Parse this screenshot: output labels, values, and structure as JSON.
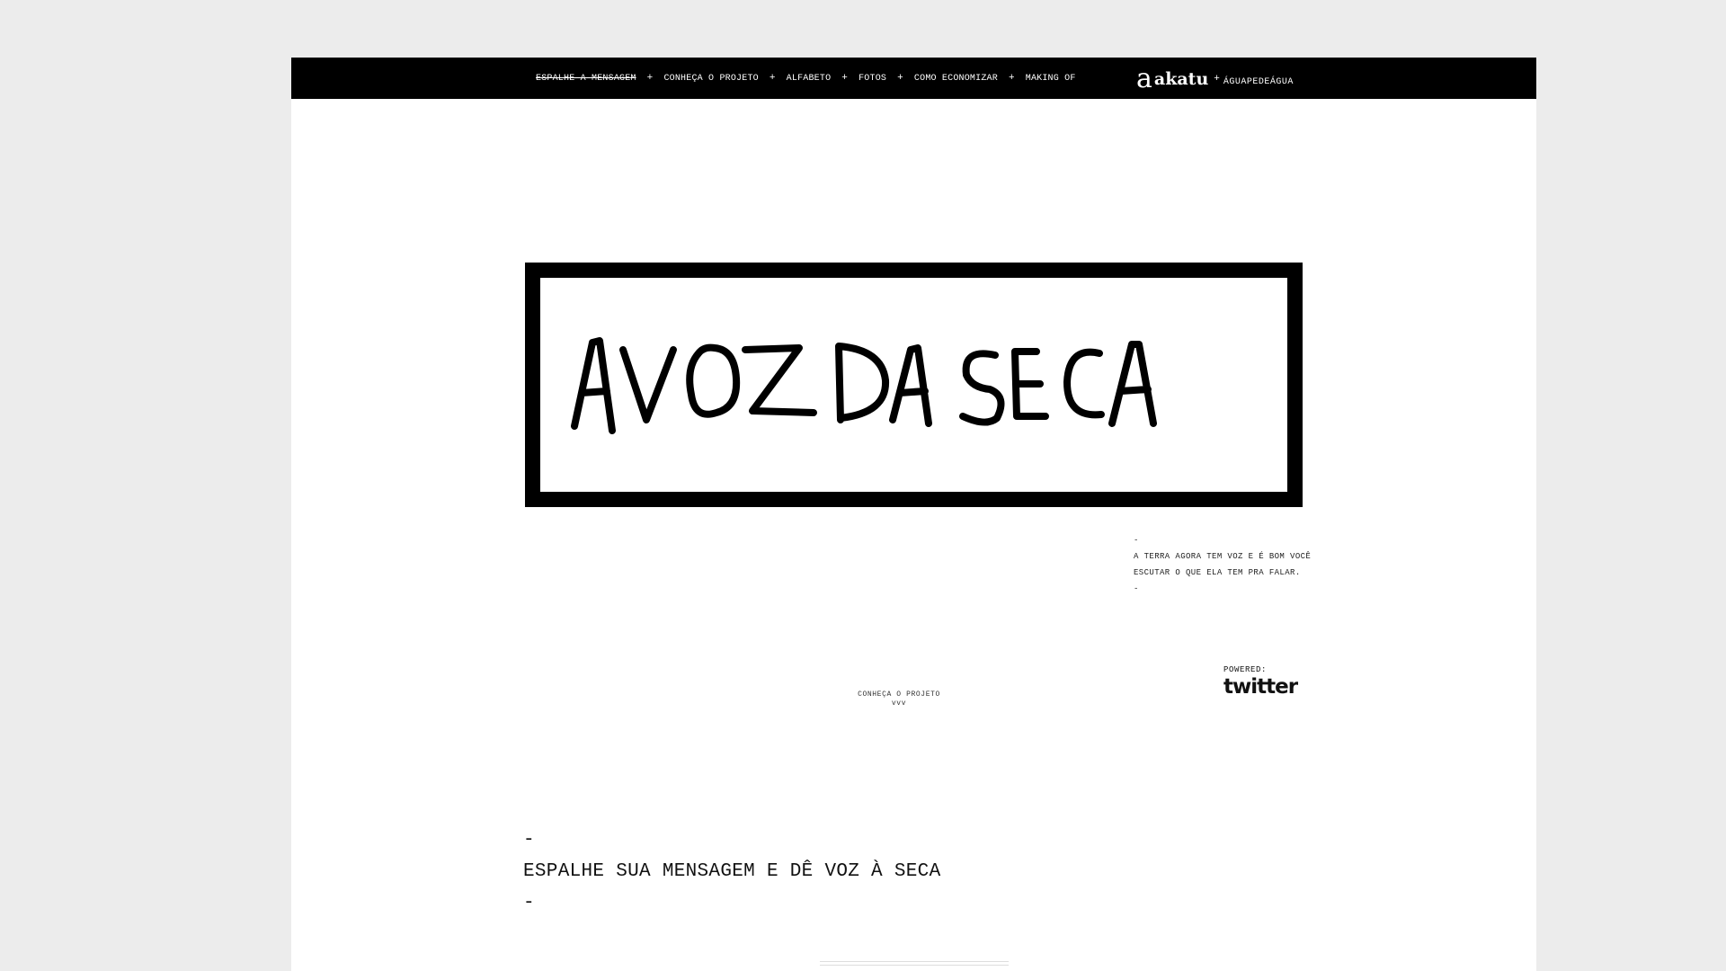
{
  "nav": {
    "items": [
      {
        "label": "ESPALHE A MENSAGEM",
        "active": true
      },
      {
        "label": "CONHEÇA O PROJETO"
      },
      {
        "label": "ALFABETO"
      },
      {
        "label": "FOTOS"
      },
      {
        "label": "COMO ECONOMIZAR"
      },
      {
        "label": "MAKING OF"
      }
    ],
    "separator": "+"
  },
  "brand": {
    "logo_letter": "a",
    "logo_word": "akatu",
    "plus": "+",
    "partner": "ÁGUAPEDEÁGUA"
  },
  "hero": {
    "title": "A VOZ DA SECA"
  },
  "tagline": {
    "dash_top": "-",
    "line1": "A TERRA AGORA TEM VOZ E É BOM VOCÊ",
    "line2": "ESCUTAR O QUE ELA TEM PRA FALAR.",
    "dash_bottom": "-"
  },
  "powered": {
    "label": "POWERED:",
    "logo": "twitter"
  },
  "cta": {
    "label": "CONHEÇA O PROJETO",
    "arrows": "vvv"
  },
  "section": {
    "dash_top": "-",
    "heading": "ESPALHE SUA MENSAGEM E DÊ VOZ À SECA",
    "dash_bottom": "-"
  }
}
